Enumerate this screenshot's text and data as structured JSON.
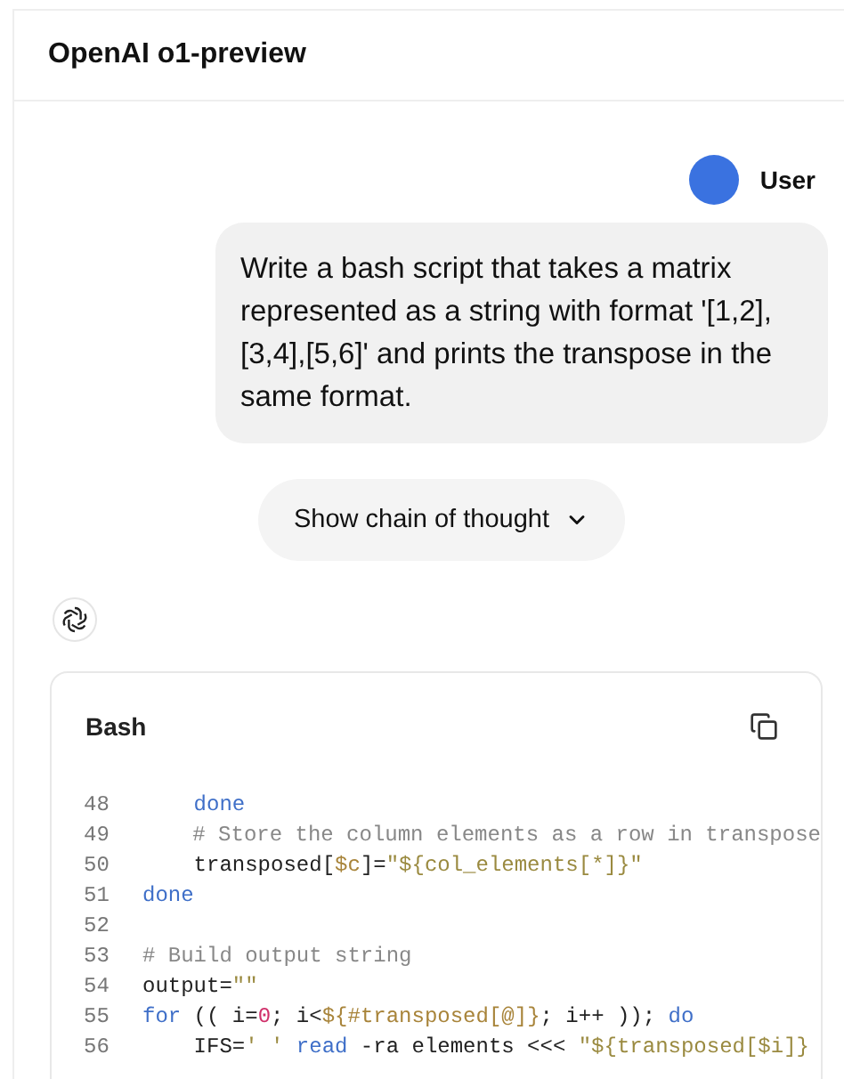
{
  "header": {
    "title": "OpenAI o1-preview"
  },
  "user": {
    "name": "User",
    "message": "Write a bash script that takes a matrix represented as a string with format '[1,2],[3,4],[5,6]' and prints the transpose in the same format."
  },
  "thought_toggle": {
    "label": "Show chain of thought",
    "expanded": false
  },
  "code_block": {
    "language": "Bash",
    "lines": [
      {
        "number": "48",
        "tokens": [
          {
            "text": "    done",
            "kind": "keyword"
          }
        ]
      },
      {
        "number": "49",
        "tokens": [
          {
            "text": "    # Store the column elements as a row in transpose",
            "kind": "comment"
          }
        ]
      },
      {
        "number": "50",
        "tokens": [
          {
            "text": "    transposed[",
            "kind": "plain"
          },
          {
            "text": "$c",
            "kind": "variable"
          },
          {
            "text": "]=",
            "kind": "plain"
          },
          {
            "text": "\"${col_elements[*]}\"",
            "kind": "string"
          }
        ]
      },
      {
        "number": "51",
        "tokens": [
          {
            "text": "done",
            "kind": "keyword"
          }
        ]
      },
      {
        "number": "52"
      },
      {
        "number": "53",
        "tokens": [
          {
            "text": "# Build output string",
            "kind": "comment"
          }
        ]
      },
      {
        "number": "54",
        "tokens": [
          {
            "text": "output=",
            "kind": "plain"
          },
          {
            "text": "\"\"",
            "kind": "string"
          }
        ]
      },
      {
        "number": "55",
        "tokens": [
          {
            "text": "for",
            "kind": "keyword"
          },
          {
            "text": " (( i=",
            "kind": "plain"
          },
          {
            "text": "0",
            "kind": "number"
          },
          {
            "text": "; i<",
            "kind": "plain"
          },
          {
            "text": "${#transposed[@]}",
            "kind": "variable"
          },
          {
            "text": "; i++ )); ",
            "kind": "plain"
          },
          {
            "text": "do",
            "kind": "keyword"
          }
        ]
      },
      {
        "number": "56",
        "tokens": [
          {
            "text": "    IFS=",
            "kind": "plain"
          },
          {
            "text": "' '",
            "kind": "string"
          },
          {
            "text": " read",
            "kind": "keyword"
          },
          {
            "text": " -ra elements <<< ",
            "kind": "plain"
          },
          {
            "text": "\"${transposed[$i]}",
            "kind": "string"
          }
        ]
      }
    ]
  }
}
